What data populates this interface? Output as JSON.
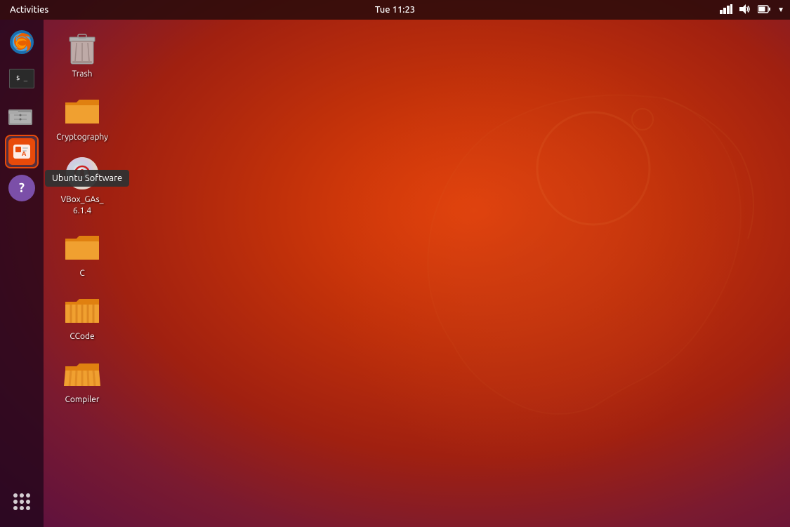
{
  "topbar": {
    "activities_label": "Activities",
    "clock": "Tue 11:23",
    "icons": {
      "network": "⊞",
      "volume": "🔊",
      "battery": "🔋",
      "dropdown": "▼"
    }
  },
  "dock": {
    "items": [
      {
        "id": "firefox",
        "label": "Firefox",
        "active": false
      },
      {
        "id": "terminal",
        "label": "Terminal",
        "active": false
      },
      {
        "id": "files",
        "label": "Files",
        "active": false
      },
      {
        "id": "ubuntu-software",
        "label": "Ubuntu Software",
        "active": true
      },
      {
        "id": "help",
        "label": "Help",
        "active": false
      }
    ],
    "bottom": {
      "show_apps_label": "Show Applications"
    }
  },
  "tooltip": {
    "text": "Ubuntu Software"
  },
  "desktop_icons": [
    {
      "id": "trash",
      "label": "Trash",
      "type": "trash"
    },
    {
      "id": "cryptography",
      "label": "Cryptography",
      "type": "folder-orange"
    },
    {
      "id": "vbox",
      "label": "VBox_GAs_\n6.1.4",
      "label_line1": "VBox_GAs_",
      "label_line2": "6.1.4",
      "type": "cd"
    },
    {
      "id": "c-folder",
      "label": "C",
      "type": "folder-orange"
    },
    {
      "id": "ccode-folder",
      "label": "CCode",
      "type": "folder-striped"
    },
    {
      "id": "compiler-folder",
      "label": "Compiler",
      "type": "folder-striped-open"
    }
  ]
}
